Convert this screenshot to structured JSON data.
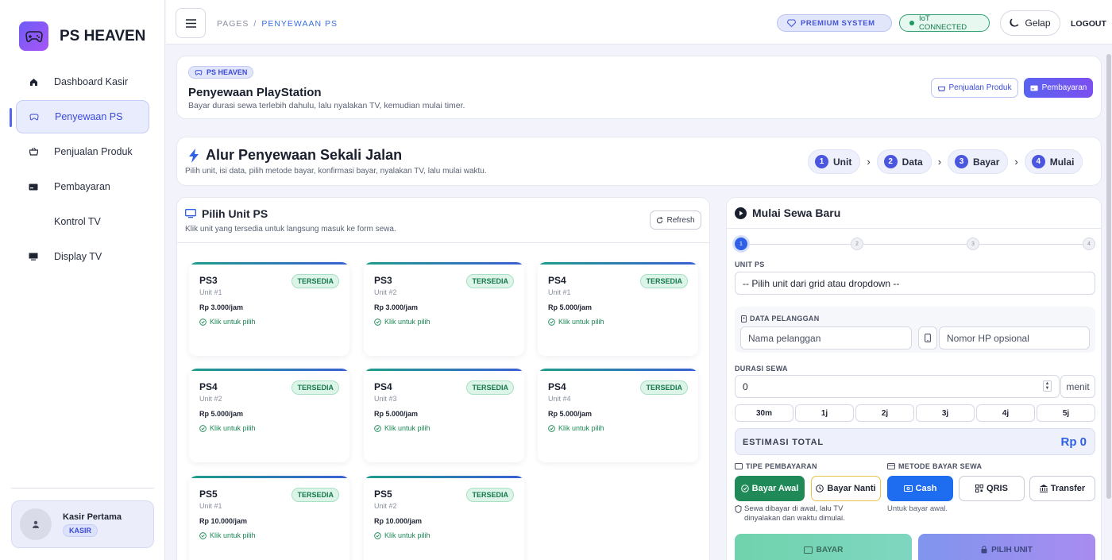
{
  "brand": {
    "name": "PS HEAVEN"
  },
  "sidebar": {
    "items": [
      {
        "label": "Dashboard Kasir",
        "icon": "home-icon"
      },
      {
        "label": "Penyewaan PS",
        "icon": "gamepad-icon",
        "active": true
      },
      {
        "label": "Penjualan Produk",
        "icon": "basket-icon"
      },
      {
        "label": "Pembayaran",
        "icon": "card-icon"
      },
      {
        "label": "Kontrol TV",
        "icon": ""
      },
      {
        "label": "Display TV",
        "icon": "monitor-icon"
      }
    ],
    "user": {
      "name": "Kasir Pertama",
      "role": "KASIR"
    }
  },
  "topbar": {
    "breadcrumb": {
      "root": "PAGES",
      "separator": "/",
      "current": "PENYEWAAN PS"
    },
    "premium": "PREMIUM SYSTEM",
    "iot": "IoT CONNECTED",
    "theme": "Gelap",
    "logout": "LOGOUT"
  },
  "header": {
    "tag": "PS HEAVEN",
    "title": "Penyewaan PlayStation",
    "subtitle": "Bayar durasi sewa terlebih dahulu, lalu nyalakan TV, kemudian mulai timer.",
    "btn_produk": "Penjualan Produk",
    "btn_bayar": "Pembayaran"
  },
  "flow": {
    "title": "Alur Penyewaan Sekali Jalan",
    "subtitle": "Pilih unit, isi data, pilih metode bayar, konfirmasi bayar, nyalakan TV, lalu mulai waktu.",
    "steps": [
      {
        "num": "1",
        "label": "Unit"
      },
      {
        "num": "2",
        "label": "Data"
      },
      {
        "num": "3",
        "label": "Bayar"
      },
      {
        "num": "4",
        "label": "Mulai"
      }
    ]
  },
  "units": {
    "title": "Pilih Unit PS",
    "subtitle": "Klik unit yang tersedia untuk langsung masuk ke form sewa.",
    "refresh": "Refresh",
    "items": [
      {
        "name": "PS3",
        "num": "Unit #1",
        "price": "Rp 3.000/jam",
        "status": "TERSEDIA",
        "hint": "Klik untuk pilih"
      },
      {
        "name": "PS3",
        "num": "Unit #2",
        "price": "Rp 3.000/jam",
        "status": "TERSEDIA",
        "hint": "Klik untuk pilih"
      },
      {
        "name": "PS4",
        "num": "Unit #1",
        "price": "Rp 5.000/jam",
        "status": "TERSEDIA",
        "hint": "Klik untuk pilih"
      },
      {
        "name": "PS4",
        "num": "Unit #2",
        "price": "Rp 5.000/jam",
        "status": "TERSEDIA",
        "hint": "Klik untuk pilih"
      },
      {
        "name": "PS4",
        "num": "Unit #3",
        "price": "Rp 5.000/jam",
        "status": "TERSEDIA",
        "hint": "Klik untuk pilih"
      },
      {
        "name": "PS4",
        "num": "Unit #4",
        "price": "Rp 5.000/jam",
        "status": "TERSEDIA",
        "hint": "Klik untuk pilih"
      },
      {
        "name": "PS5",
        "num": "Unit #1",
        "price": "Rp 10.000/jam",
        "status": "TERSEDIA",
        "hint": "Klik untuk pilih"
      },
      {
        "name": "PS5",
        "num": "Unit #2",
        "price": "Rp 10.000/jam",
        "status": "TERSEDIA",
        "hint": "Klik untuk pilih"
      }
    ]
  },
  "form": {
    "title": "Mulai Sewa Baru",
    "progress": [
      "1",
      "2",
      "3",
      "4"
    ],
    "unit_label": "UNIT PS",
    "unit_value": "-- Pilih unit dari grid atau dropdown --",
    "customer_label": "DATA PELANGGAN",
    "name_placeholder": "Nama pelanggan",
    "phone_placeholder": "Nomor HP opsional",
    "duration_label": "DURASI SEWA",
    "duration_value": "0",
    "duration_unit": "menit",
    "presets": [
      "30m",
      "1j",
      "2j",
      "3j",
      "4j",
      "5j"
    ],
    "estimate_label": "ESTIMASI TOTAL",
    "estimate_value": "Rp 0",
    "pay_type_label": "TIPE PEMBAYARAN",
    "pay_now": "Bayar Awal",
    "pay_later": "Bayar Nanti",
    "pay_type_note": "Sewa dibayar di awal, lalu TV dinyalakan dan waktu dimulai.",
    "method_label": "METODE BAYAR SEWA",
    "methods": [
      "Cash",
      "QRIS",
      "Transfer"
    ],
    "method_note": "Untuk bayar awal.",
    "btn_pay": "BAYAR",
    "btn_pick": "PILIH UNIT"
  },
  "colors": {
    "accent": "#3b4ad6",
    "success": "#1b8a55",
    "primary": "#2f5fe6"
  }
}
